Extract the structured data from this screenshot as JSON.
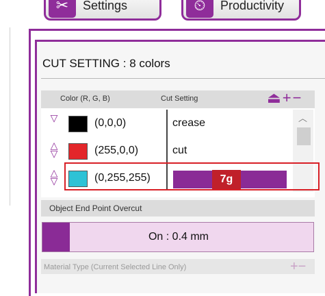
{
  "top_buttons": {
    "settings_label": "Settings",
    "productivity_label": "Productivity"
  },
  "cut_setting": {
    "title": "CUT SETTING : 8 colors",
    "headers": {
      "color": "Color (R, G, B)",
      "cut": "Cut Setting"
    },
    "rows": [
      {
        "rgb": "(0,0,0)",
        "cut": "crease",
        "swatch": "#000000"
      },
      {
        "rgb": "(255,0,0)",
        "cut": "cut",
        "swatch": "#e3262a"
      },
      {
        "rgb": "(0,255,255)",
        "cut": "",
        "swatch": "#2ec2d6"
      }
    ]
  },
  "callout": {
    "label": "7g"
  },
  "overcut": {
    "label": "Object End Point Overcut",
    "value": "On : 0.4 mm"
  },
  "material": {
    "label": "Material Type (Current Selected Line Only)"
  },
  "colors": {
    "accent": "#8f2d9a",
    "callout": "#c0202a"
  }
}
